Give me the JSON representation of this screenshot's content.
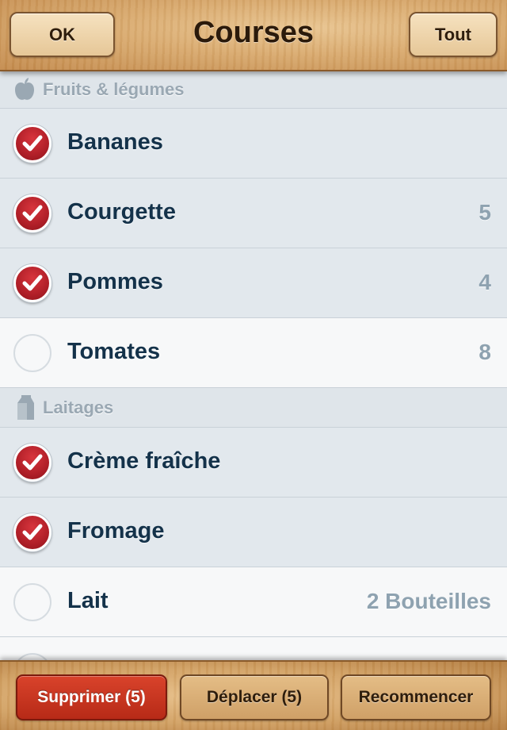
{
  "header": {
    "title": "Courses",
    "left_button": "OK",
    "right_button": "Tout"
  },
  "sections": [
    {
      "title": "Fruits & légumes",
      "icon": "apple-icon",
      "items": [
        {
          "name": "Bananes",
          "qty": "",
          "checked": true
        },
        {
          "name": "Courgette",
          "qty": "5",
          "checked": true
        },
        {
          "name": "Pommes",
          "qty": "4",
          "checked": true
        },
        {
          "name": "Tomates",
          "qty": "8",
          "checked": false
        }
      ]
    },
    {
      "title": "Laitages",
      "icon": "milk-carton-icon",
      "items": [
        {
          "name": "Crème fraîche",
          "qty": "",
          "checked": true
        },
        {
          "name": "Fromage",
          "qty": "",
          "checked": true
        },
        {
          "name": "Lait",
          "qty": "2 Bouteilles",
          "checked": false
        },
        {
          "name": "",
          "qty": "",
          "checked": false
        }
      ]
    }
  ],
  "toolbar": {
    "delete_label": "Supprimer (5)",
    "move_label": "Déplacer (5)",
    "restart_label": "Recommencer"
  },
  "colors": {
    "checked_red": "#b01f28",
    "item_text": "#14324a",
    "qty_text": "#8ea2b0",
    "delete_red": "#c9341f"
  }
}
